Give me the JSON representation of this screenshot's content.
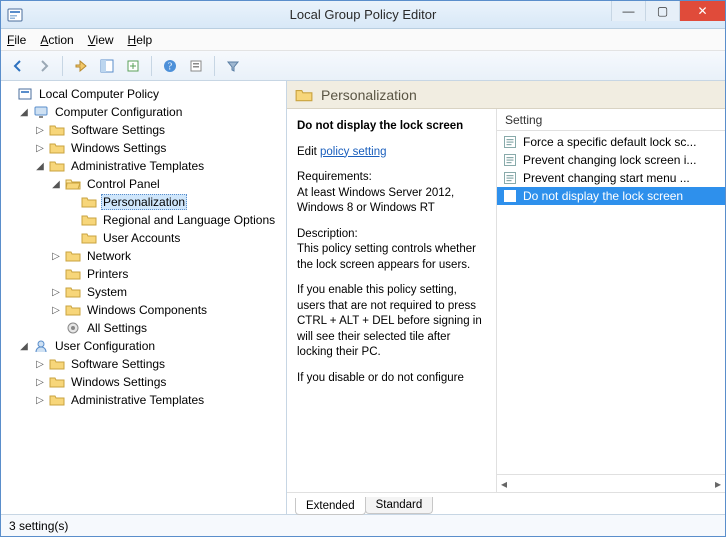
{
  "window": {
    "title": "Local Group Policy Editor",
    "min": "—",
    "max": "▢",
    "close": "✕"
  },
  "menu": {
    "file": "File",
    "action": "Action",
    "view": "View",
    "help": "Help"
  },
  "tree": {
    "root": "Local Computer Policy",
    "computer_config": "Computer Configuration",
    "cc_software": "Software Settings",
    "cc_windows": "Windows Settings",
    "cc_admin": "Administrative Templates",
    "control_panel": "Control Panel",
    "personalization": "Personalization",
    "regional": "Regional and Language Options",
    "user_accounts": "User Accounts",
    "network": "Network",
    "printers": "Printers",
    "system": "System",
    "win_components": "Windows Components",
    "all_settings": "All Settings",
    "user_config": "User Configuration",
    "uc_software": "Software Settings",
    "uc_windows": "Windows Settings",
    "uc_admin": "Administrative Templates"
  },
  "panel": {
    "title": "Personalization"
  },
  "detail": {
    "item_title": "Do not display the lock screen",
    "edit_prefix": "Edit ",
    "edit_link": "policy setting",
    "req_label": "Requirements:",
    "req_text": "At least Windows Server 2012, Windows 8 or Windows RT",
    "desc_label": "Description:",
    "desc1": "This policy setting controls whether the lock screen appears for users.",
    "desc2": "If you enable this policy setting, users that are not required to press CTRL + ALT + DEL before signing in will see their selected tile after locking their PC.",
    "desc3": "If you disable or do not configure"
  },
  "list": {
    "header": "Setting",
    "items": [
      "Force a specific default lock sc...",
      "Prevent changing lock screen i...",
      "Prevent changing start menu ...",
      "Do not display the lock screen"
    ],
    "selected_index": 3
  },
  "tabs": {
    "extended": "Extended",
    "standard": "Standard"
  },
  "status": {
    "text": "3 setting(s)"
  }
}
